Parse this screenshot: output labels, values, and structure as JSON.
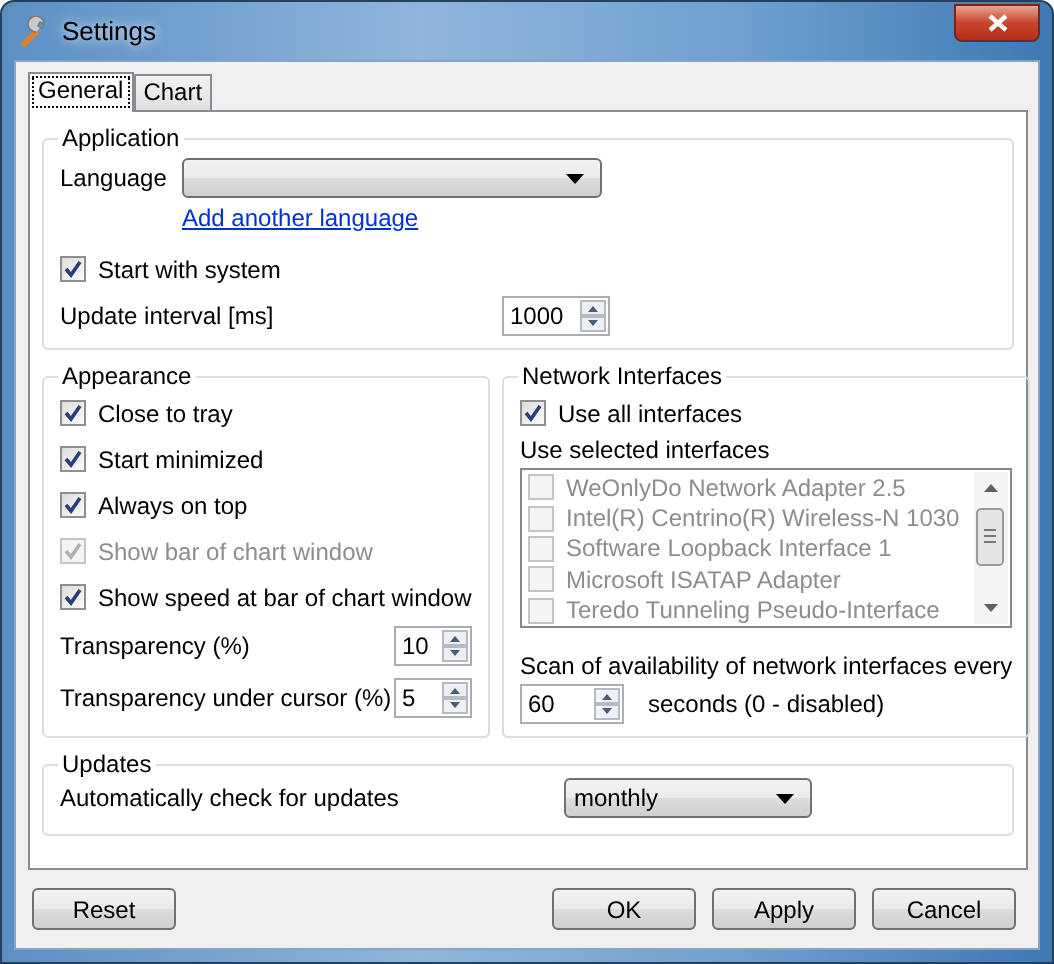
{
  "window": {
    "title": "Settings"
  },
  "tabs": [
    {
      "label": "General",
      "selected": true
    },
    {
      "label": "Chart",
      "selected": false
    }
  ],
  "application": {
    "title": "Application",
    "language_label": "Language",
    "link": "Add another language",
    "start_with_system": {
      "label": "Start with system",
      "checked": true
    },
    "update_interval": {
      "label": "Update interval [ms]",
      "value": "1000"
    }
  },
  "appearance": {
    "title": "Appearance",
    "options": [
      {
        "label": "Close to tray",
        "checked": true,
        "disabled": false
      },
      {
        "label": "Start minimized",
        "checked": true,
        "disabled": false
      },
      {
        "label": "Always on top",
        "checked": true,
        "disabled": false
      },
      {
        "label": "Show bar of chart window",
        "checked": true,
        "disabled": true
      },
      {
        "label": "Show speed at bar of chart window",
        "checked": true,
        "disabled": false
      }
    ],
    "spinners": [
      {
        "label": "Transparency (%)",
        "value": "10"
      },
      {
        "label": "Transparency under cursor (%)",
        "value": "5"
      }
    ]
  },
  "network": {
    "title": "Network Interfaces",
    "use_all": {
      "label": "Use all interfaces",
      "checked": true
    },
    "list_label": "Use selected interfaces",
    "interfaces": [
      {
        "label": "WeOnlyDo Network Adapter 2.5",
        "checked": false,
        "disabled": true
      },
      {
        "label": "Intel(R) Centrino(R) Wireless-N 1030",
        "checked": false,
        "disabled": true
      },
      {
        "label": "Software Loopback Interface 1",
        "checked": false,
        "disabled": true
      },
      {
        "label": "Microsoft ISATAP Adapter",
        "checked": false,
        "disabled": true
      },
      {
        "label": "Teredo Tunneling Pseudo-Interface",
        "checked": false,
        "disabled": true
      }
    ],
    "scan_label": "Scan of availability of network interfaces every",
    "scan_value": "60",
    "scan_suffix": "seconds (0 - disabled)"
  },
  "updates": {
    "title": "Updates",
    "label": "Automatically check for updates",
    "value": "monthly"
  },
  "left_buttons": [
    "Reset"
  ],
  "right_buttons": [
    "OK",
    "Apply",
    "Cancel"
  ]
}
